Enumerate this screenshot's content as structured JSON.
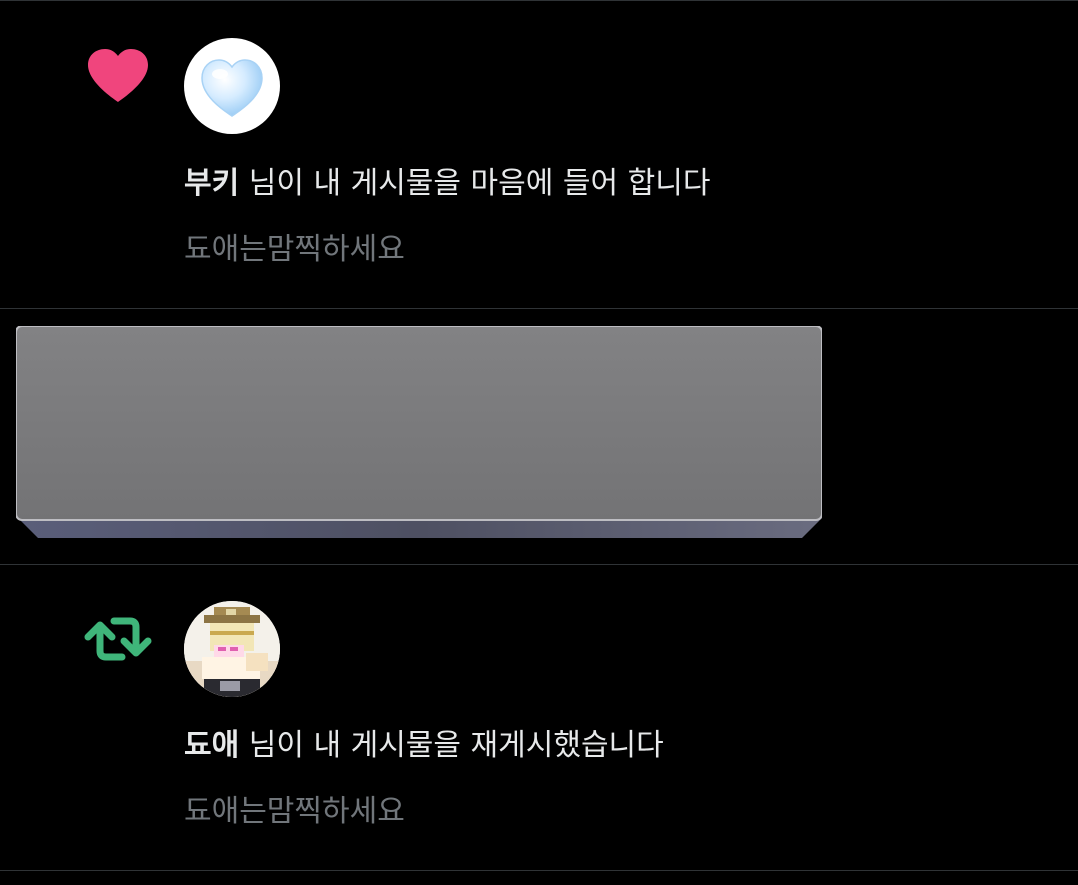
{
  "notifications": [
    {
      "type": "like",
      "type_icon": "heart-icon",
      "type_icon_color": "#f0457d",
      "avatar": "blue-heart-avatar",
      "username": "부키",
      "message": " 님이 내 게시물을 마음에 들어 합니다",
      "snippet": "됴애는맘찍하세요"
    },
    {
      "type": "repost",
      "type_icon": "repost-icon",
      "type_icon_color": "#3fb57a",
      "avatar": "pixel-character-avatar",
      "username": "됴애",
      "message": " 님이 내 게시물을 재게시했습니다",
      "snippet": "됴애는맘찍하세요"
    }
  ],
  "redacted_block": {
    "fill_color": "#7a7a7c"
  }
}
